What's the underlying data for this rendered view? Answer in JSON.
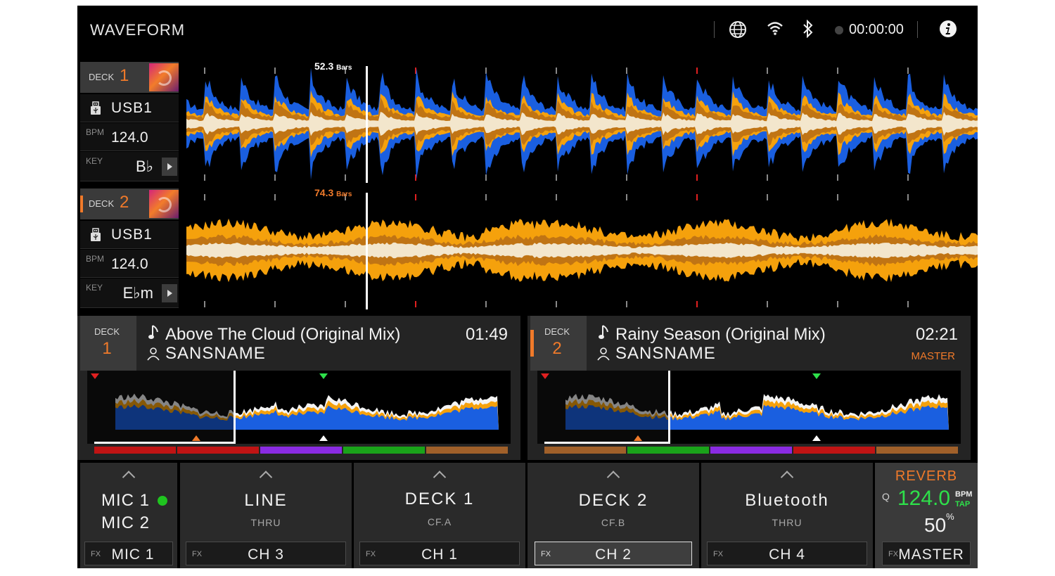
{
  "app": {
    "title": "WAVEFORM",
    "timer": "00:00:00"
  },
  "status_icons": [
    "globe-icon",
    "wifi-icon",
    "bluetooth-icon",
    "record-dot-icon",
    "info-icon"
  ],
  "decks": [
    {
      "label": "DECK",
      "number": "1",
      "source": "USB1",
      "bpm_label": "BPM",
      "bpm": "124.0",
      "key_label": "KEY",
      "key": "B♭",
      "bars": "52.3",
      "bars_unit": "Bars",
      "track": {
        "title": "Above The Cloud (Original Mix)",
        "artist": "SANSNAME",
        "time": "01:49",
        "status": ""
      }
    },
    {
      "label": "DECK",
      "number": "2",
      "source": "USB1",
      "bpm_label": "BPM",
      "bpm": "124.0",
      "key_label": "KEY",
      "key": "E♭m",
      "bars": "74.3",
      "bars_unit": "Bars",
      "track": {
        "title": "Rainy Season (Original Mix)",
        "artist": "SANSNAME",
        "time": "02:21",
        "status": "MASTER"
      }
    }
  ],
  "channels": [
    {
      "name": "MIC 1",
      "name2": "MIC 2",
      "sub": "",
      "fx_label": "FX",
      "fx": "MIC 1",
      "active": false
    },
    {
      "name": "LINE",
      "sub": "THRU",
      "fx_label": "FX",
      "fx": "CH 3",
      "active": false
    },
    {
      "name": "DECK 1",
      "sub": "CF.A",
      "fx_label": "FX",
      "fx": "CH 1",
      "active": false
    },
    {
      "name": "DECK 2",
      "sub": "CF.B",
      "fx_label": "FX",
      "fx": "CH 2",
      "active": true
    },
    {
      "name": "Bluetooth",
      "sub": "THRU",
      "fx_label": "FX",
      "fx": "CH 4",
      "active": false
    }
  ],
  "reverb": {
    "name": "REVERB",
    "q": "Q",
    "bpm": "124.0",
    "bpm_label": "BPM",
    "tap": "TAP",
    "level": "50",
    "level_unit": "%",
    "fx_label": "FX",
    "fx": "MASTER"
  },
  "colors": {
    "accent": "#f07a2a",
    "green": "#2ee04a",
    "wave_blue": "#1a5fe0",
    "wave_orange": "#f5a10c"
  }
}
